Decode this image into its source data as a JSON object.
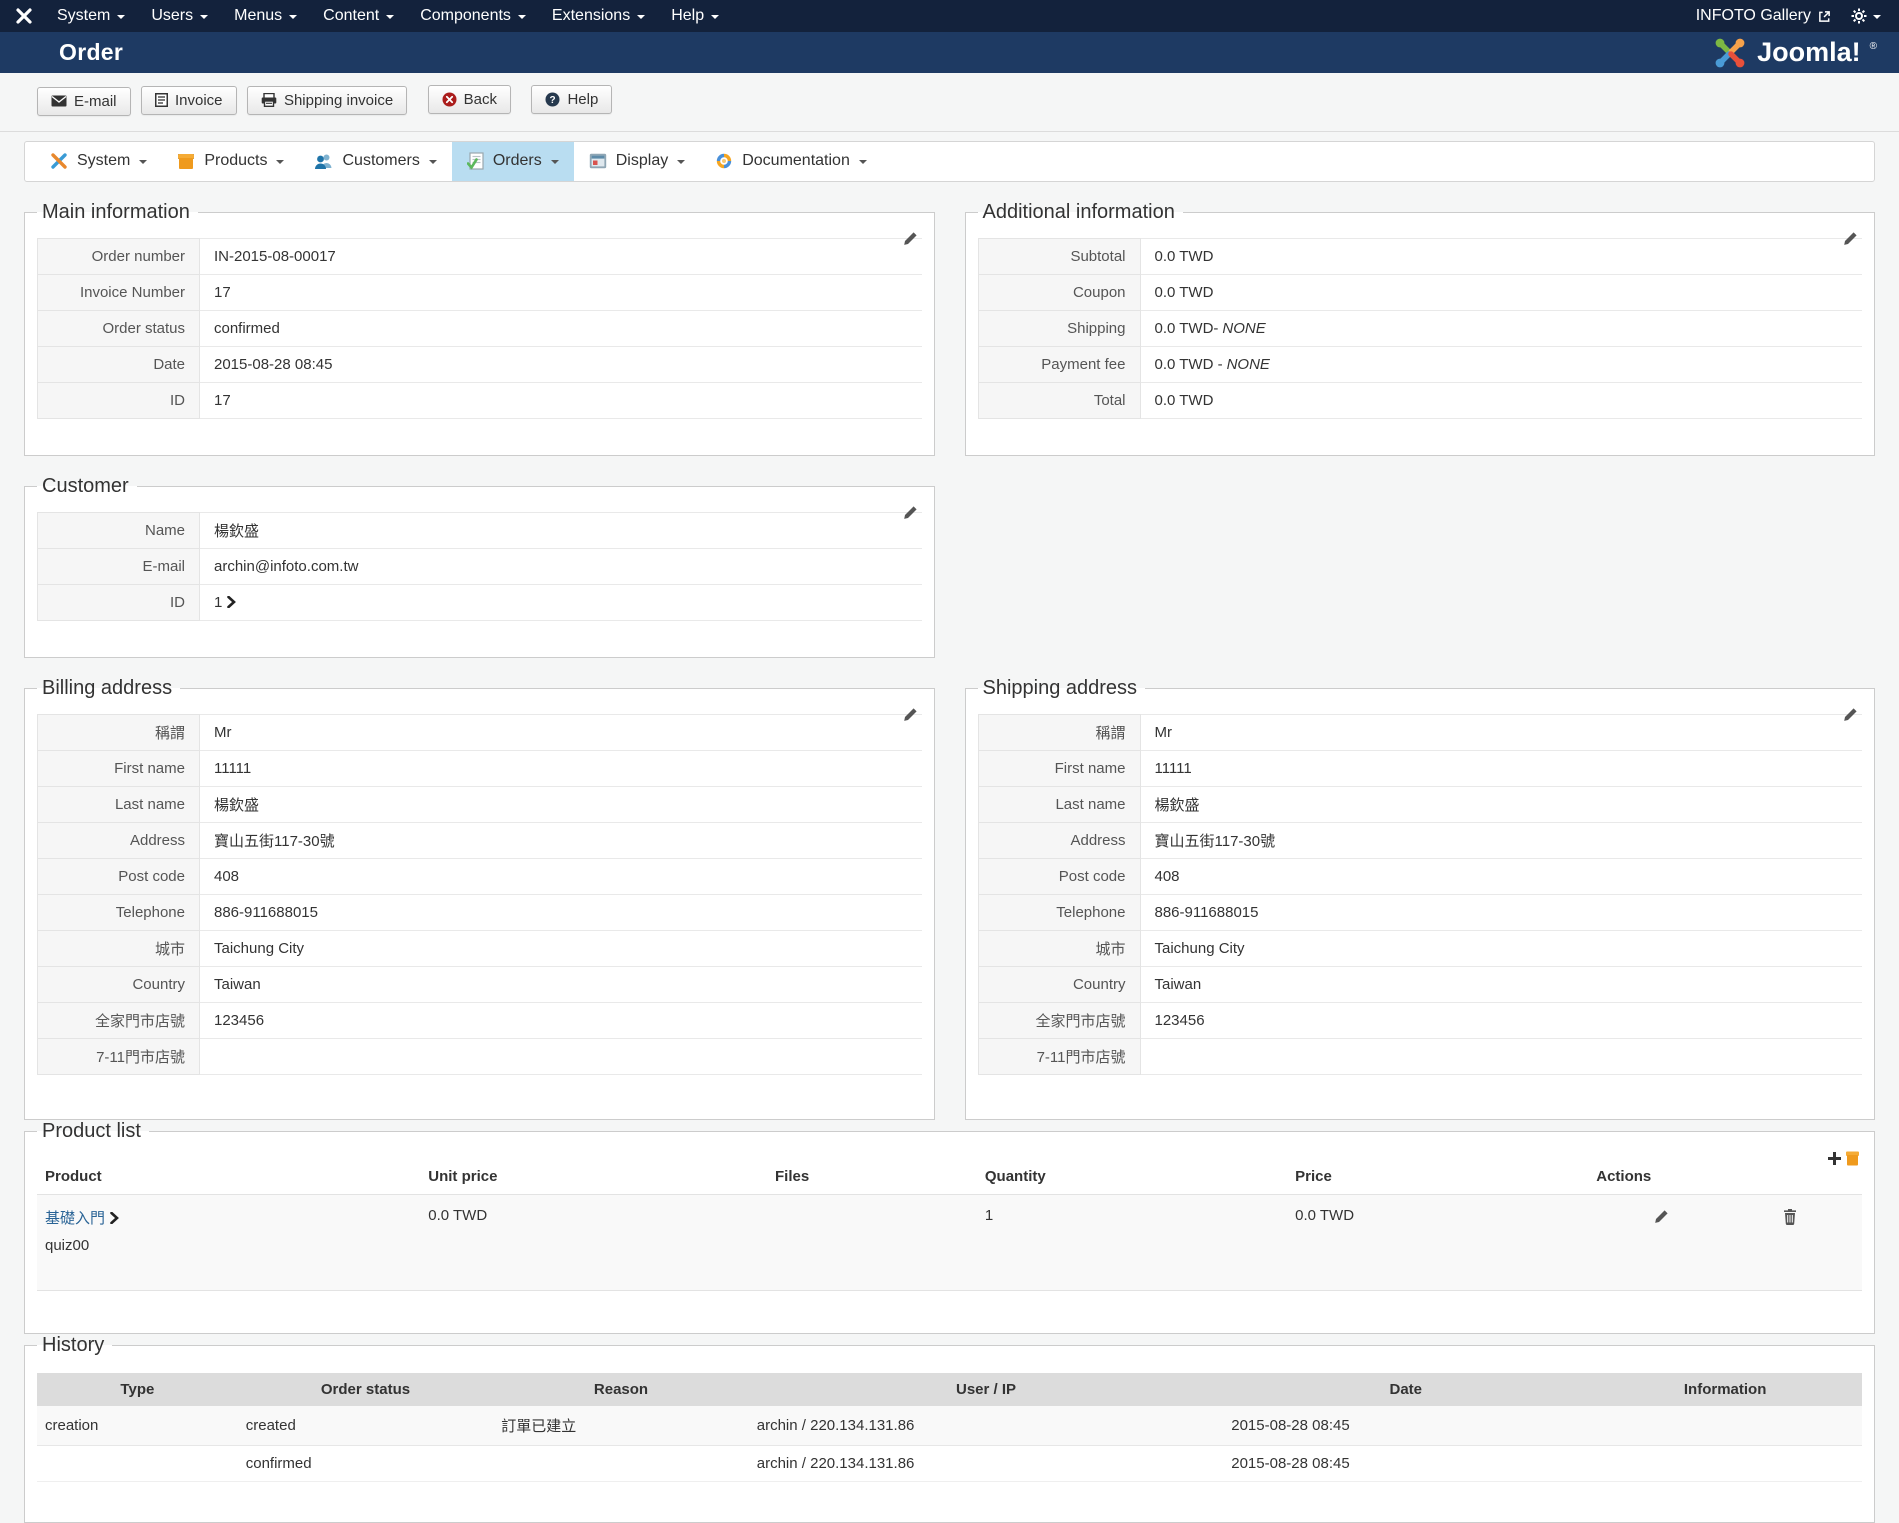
{
  "admin_bar": {
    "menus": [
      "System",
      "Users",
      "Menus",
      "Content",
      "Components",
      "Extensions",
      "Help"
    ],
    "site_link": "INFOTO Gallery"
  },
  "title_bar": {
    "title": "Order",
    "brand": "Joomla!",
    "reg": "®"
  },
  "toolbar": {
    "email": "E-mail",
    "invoice": "Invoice",
    "shipping_invoice": "Shipping invoice",
    "back": "Back",
    "help": "Help"
  },
  "vm_nav": {
    "items": [
      {
        "label": "System"
      },
      {
        "label": "Products"
      },
      {
        "label": "Customers"
      },
      {
        "label": "Orders"
      },
      {
        "label": "Display"
      },
      {
        "label": "Documentation"
      }
    ]
  },
  "main_info": {
    "legend": "Main information",
    "rows": [
      {
        "label": "Order number",
        "value": "IN-2015-08-00017"
      },
      {
        "label": "Invoice Number",
        "value": "17"
      },
      {
        "label": "Order status",
        "value": "confirmed"
      },
      {
        "label": "Date",
        "value": "2015-08-28 08:45"
      },
      {
        "label": "ID",
        "value": "17"
      }
    ]
  },
  "additional_info": {
    "legend": "Additional information",
    "rows": [
      {
        "label": "Subtotal",
        "value": "0.0 TWD"
      },
      {
        "label": "Coupon",
        "value": "0.0 TWD"
      },
      {
        "label": "Shipping",
        "value": "0.0 TWD-",
        "none": "NONE"
      },
      {
        "label": "Payment fee",
        "value": "0.0 TWD -",
        "none": "NONE"
      },
      {
        "label": "Total",
        "value": "0.0 TWD"
      }
    ]
  },
  "customer": {
    "legend": "Customer",
    "rows": [
      {
        "label": "Name",
        "value": "楊欽盛"
      },
      {
        "label": "E-mail",
        "value": "archin@infoto.com.tw"
      },
      {
        "label": "ID",
        "value": "1"
      }
    ]
  },
  "billing": {
    "legend": "Billing address",
    "rows": [
      {
        "label": "稱謂",
        "value": "Mr"
      },
      {
        "label": "First name",
        "value": "11111"
      },
      {
        "label": "Last name",
        "value": "楊欽盛"
      },
      {
        "label": "Address",
        "value": "寶山五街117-30號"
      },
      {
        "label": "Post code",
        "value": "408"
      },
      {
        "label": "Telephone",
        "value": "886-911688015"
      },
      {
        "label": "城市",
        "value": "Taichung City"
      },
      {
        "label": "Country",
        "value": "Taiwan"
      },
      {
        "label": "全家門市店號",
        "value": "123456"
      },
      {
        "label": "7-11門市店號",
        "value": ""
      }
    ]
  },
  "shipping": {
    "legend": "Shipping address",
    "rows": [
      {
        "label": "稱謂",
        "value": "Mr"
      },
      {
        "label": "First name",
        "value": "11111"
      },
      {
        "label": "Last name",
        "value": "楊欽盛"
      },
      {
        "label": "Address",
        "value": "寶山五街117-30號"
      },
      {
        "label": "Post code",
        "value": "408"
      },
      {
        "label": "Telephone",
        "value": "886-911688015"
      },
      {
        "label": "城市",
        "value": "Taichung City"
      },
      {
        "label": "Country",
        "value": "Taiwan"
      },
      {
        "label": "全家門市店號",
        "value": "123456"
      },
      {
        "label": "7-11門市店號",
        "value": ""
      }
    ]
  },
  "product_list": {
    "legend": "Product list",
    "headers": [
      "Product",
      "Unit price",
      "Files",
      "Quantity",
      "Price",
      "Actions"
    ],
    "row": {
      "name": "基礎入門",
      "sku": "quiz00",
      "unit_price": "0.0 TWD",
      "files": "",
      "quantity": "1",
      "price": "0.0 TWD"
    }
  },
  "history": {
    "legend": "History",
    "headers": [
      "Type",
      "Order status",
      "Reason",
      "User / IP",
      "Date",
      "Information"
    ],
    "rows": [
      {
        "type": "creation",
        "status": "created",
        "reason": "訂單已建立",
        "user_ip": "archin / 220.134.131.86",
        "date": "2015-08-28 08:45",
        "info": ""
      },
      {
        "type": "",
        "status": "confirmed",
        "reason": "",
        "user_ip": "archin / 220.134.131.86",
        "date": "2015-08-28 08:45",
        "info": ""
      }
    ]
  },
  "colors": {
    "admin_bar": "#13223c",
    "title_bar": "#1e3a63",
    "active_nav": "#b9ddf1",
    "link": "#2a6496",
    "status_red": "#ab1d1c"
  }
}
